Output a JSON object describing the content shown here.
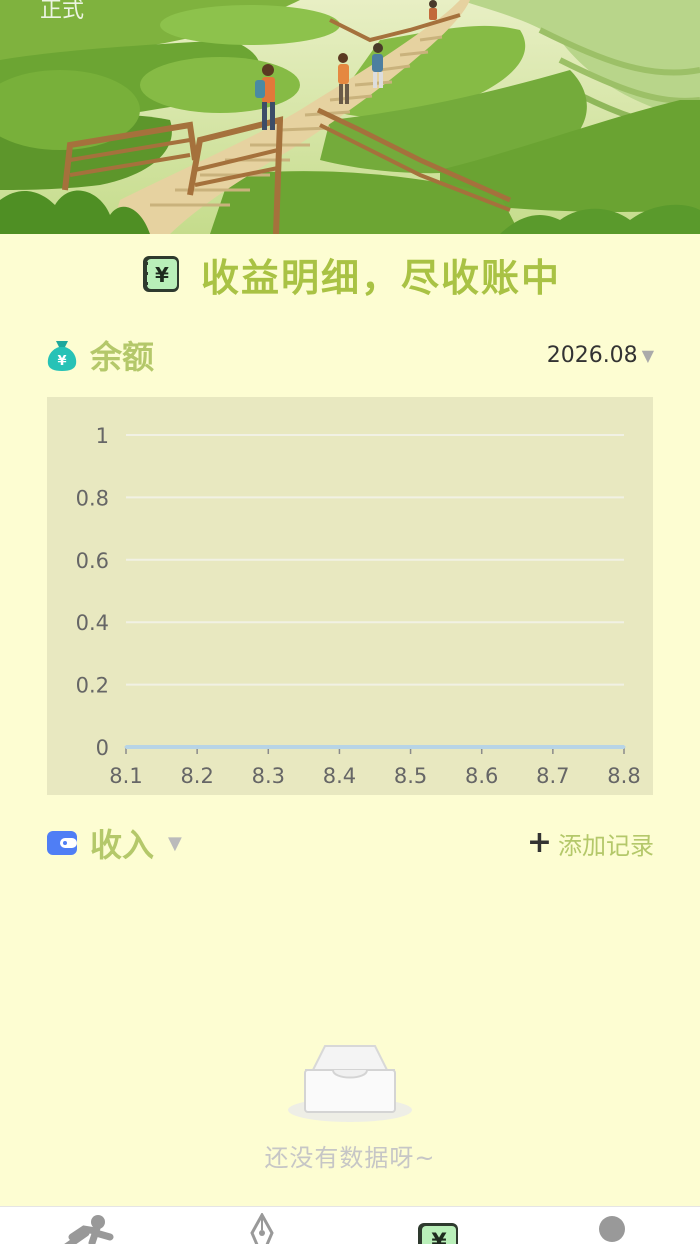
{
  "env_tag": "正式",
  "title": "收益明细，尽收账中",
  "balance": {
    "title": "余额",
    "month": "2026.08",
    "icon": "money-bag-icon"
  },
  "chart_data": {
    "type": "line",
    "title": "",
    "xlabel": "",
    "ylabel": "",
    "categories": [
      "8.1",
      "8.2",
      "8.3",
      "8.4",
      "8.5",
      "8.6",
      "8.7",
      "8.8"
    ],
    "series": [
      {
        "values": [
          0,
          0,
          0,
          0,
          0,
          0,
          0,
          0
        ]
      }
    ],
    "yticks": [
      "0",
      "0.2",
      "0.4",
      "0.6",
      "0.8",
      "1"
    ],
    "ylim": [
      0,
      1
    ],
    "grid": true,
    "colors": {
      "line": "#b7d4e6",
      "grid": "#f1f1e4",
      "background": "#e8e8c0"
    }
  },
  "income": {
    "title": "收入",
    "add_label": "添加记录",
    "icon": "wallet-icon"
  },
  "empty": {
    "text": "还没有数据呀~",
    "icon": "empty-inbox-icon"
  },
  "tabs": [
    {
      "name": "tab-sport",
      "icon": "running-person-icon"
    },
    {
      "name": "tab-pen",
      "icon": "pen-nib-icon"
    },
    {
      "name": "tab-earnings",
      "icon": "yuan-card-icon",
      "active": true
    },
    {
      "name": "tab-profile",
      "icon": "avatar-icon"
    }
  ],
  "colors": {
    "accent": "#a9c244",
    "section_title": "#b4c86a",
    "background": "#fdfdd2",
    "icon_teal": "#22b8b0",
    "icon_blue": "#4f7ef5"
  }
}
